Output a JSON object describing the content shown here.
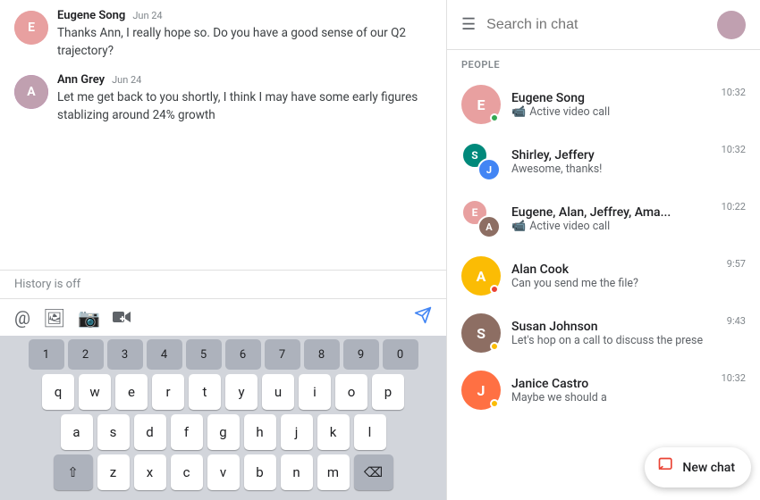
{
  "left": {
    "messages": [
      {
        "sender": "Eugene Song",
        "date": "Jun 24",
        "text": "Thanks Ann, I really hope so. Do you have a good sense of our Q2 trajectory?",
        "avatarColor": "av-pink",
        "avatarInitial": "E"
      },
      {
        "sender": "Ann Grey",
        "date": "Jun 24",
        "text": "Let me get back to you shortly, I think I may have some early figures stablizing around 24% growth",
        "avatarColor": "av-purple",
        "avatarInitial": "A"
      }
    ],
    "historyBar": "History is off",
    "keyboard": {
      "numbers": [
        "1",
        "2",
        "3",
        "4",
        "5",
        "6",
        "7",
        "8",
        "9",
        "0"
      ],
      "row1": [
        "q",
        "w",
        "e",
        "r",
        "t",
        "y",
        "u",
        "i",
        "o",
        "p"
      ],
      "row2": [
        "a",
        "s",
        "d",
        "f",
        "g",
        "h",
        "j",
        "k",
        "l"
      ],
      "row3": [
        "z",
        "x",
        "c",
        "v",
        "b",
        "n",
        "m"
      ]
    }
  },
  "right": {
    "searchPlaceholder": "Search in chat",
    "peopleLabel": "PEOPLE",
    "chats": [
      {
        "name": "Eugene Song",
        "time": "10:32",
        "preview": "Active video call",
        "avatarColor": "av-pink",
        "initial": "E",
        "isVideoCall": true,
        "statusDot": "green"
      },
      {
        "name": "Shirley, Jeffery",
        "time": "10:32",
        "preview": "Awesome, thanks!",
        "avatarColor": "av-teal",
        "initial": "S",
        "isGroup": true,
        "secondAvatarColor": "av-blue",
        "secondInitial": "J",
        "statusDot": "none"
      },
      {
        "name": "Eugene, Alan, Jeffrey, Ama...",
        "time": "10:22",
        "preview": "Active video call",
        "avatarColor": "av-pink",
        "initial": "E",
        "isGroup": true,
        "secondAvatarColor": "av-brown",
        "secondInitial": "A",
        "isVideoCall": true,
        "statusDot": "none"
      },
      {
        "name": "Alan Cook",
        "time": "9:57",
        "preview": "Can you send me the file?",
        "avatarColor": "av-yellow",
        "initial": "A",
        "statusDot": "red"
      },
      {
        "name": "Susan Johnson",
        "time": "9:43",
        "preview": "Let's hop on a call to discuss the prese",
        "avatarColor": "av-brown",
        "initial": "S",
        "statusDot": "orange"
      },
      {
        "name": "Janice Castro",
        "time": "10:32",
        "preview": "Maybe we should a",
        "avatarColor": "av-orange",
        "initial": "J",
        "statusDot": "orange"
      }
    ],
    "newChat": "New chat"
  }
}
